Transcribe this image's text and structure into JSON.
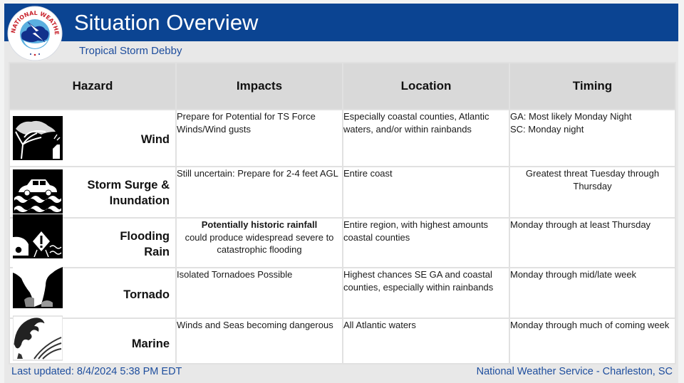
{
  "header": {
    "title": "Situation Overview",
    "subtitle": "Tropical Storm Debby",
    "logo": "nws-logo-icon",
    "logo_text": "NATIONAL WEATHER SERVICE",
    "banner_color": "#0b4492"
  },
  "table": {
    "columns": [
      "Hazard",
      "Impacts",
      "Location",
      "Timing"
    ],
    "rows": [
      {
        "hazard": "Wind",
        "hazard_line2": "",
        "icon": "wind-tree-icon",
        "impacts": "Prepare for Potential for TS Force Winds/Wind gusts",
        "impacts_bold": "",
        "location": "Especially coastal counties, Atlantic waters, and/or within rainbands",
        "timing": "GA: Most likely Monday Night",
        "timing_line2": "SC: Monday night"
      },
      {
        "hazard": "Storm Surge &",
        "hazard_line2": "Inundation",
        "icon": "storm-surge-car-icon",
        "impacts": "Still uncertain: Prepare for 2-4 feet AGL",
        "impacts_bold": "",
        "location": "Entire coast",
        "timing": "Greatest threat Tuesday through Thursday",
        "timing_line2": ""
      },
      {
        "hazard": "Flooding",
        "hazard_line2": "Rain",
        "icon": "flooding-rain-icon",
        "impacts_bold": "Potentially historic rainfall",
        "impacts": "could produce widespread severe to catastrophic flooding",
        "location": "Entire region, with highest amounts coastal counties",
        "timing": "Monday through at least Thursday",
        "timing_line2": ""
      },
      {
        "hazard": "Tornado",
        "hazard_line2": "",
        "icon": "tornado-icon",
        "impacts": "Isolated Tornadoes Possible",
        "impacts_bold": "",
        "location": "Highest chances SE GA and coastal counties, especially within rainbands",
        "timing": "Monday through mid/late week",
        "timing_line2": ""
      },
      {
        "hazard": "Marine",
        "hazard_line2": "",
        "icon": "marine-wave-icon",
        "impacts": "Winds and Seas becoming dangerous",
        "impacts_bold": "",
        "location": "All Atlantic waters",
        "timing": "Monday through much of coming week",
        "timing_line2": ""
      }
    ]
  },
  "footer": {
    "last_updated": "Last updated: 8/4/2024 5:38 PM EDT",
    "office": "National Weather Service - Charleston, SC"
  }
}
